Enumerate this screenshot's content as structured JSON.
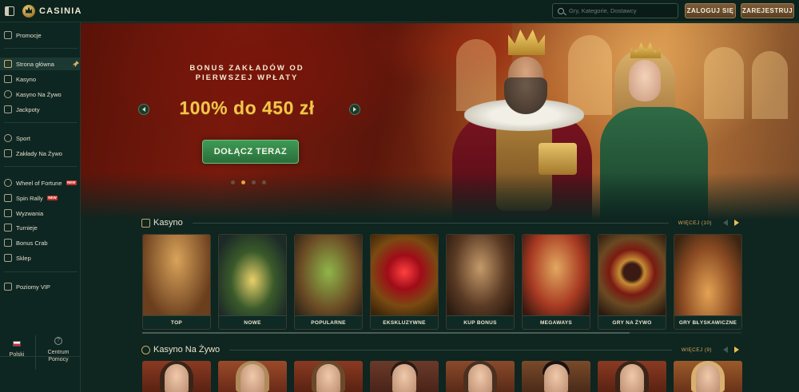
{
  "header": {
    "brand": "CASINIA",
    "search_placeholder": "Gry, Kategorie, Dostawcy",
    "login_label": "ZALOGUJ SIĘ",
    "register_label": "ZAREJESTRUJ"
  },
  "sidebar": {
    "items": [
      {
        "label": "Promocje",
        "icon": "gift-icon"
      },
      {
        "label": "Strona główna",
        "icon": "home-icon",
        "active": true
      },
      {
        "label": "Kasyno",
        "icon": "slot-icon"
      },
      {
        "label": "Kasyno Na Żywo",
        "icon": "chip-icon"
      },
      {
        "label": "Jackpoty",
        "icon": "jackpot-icon"
      },
      {
        "label": "Sport",
        "icon": "ball-icon"
      },
      {
        "label": "Zakłady Na Żywo",
        "icon": "live-bet-icon"
      },
      {
        "label": "Wheel of Fortune",
        "icon": "wheel-icon",
        "badge": "NEW"
      },
      {
        "label": "Spin Rally",
        "icon": "rally-icon",
        "badge": "NEW"
      },
      {
        "label": "Wyzwania",
        "icon": "challenge-icon"
      },
      {
        "label": "Turnieje",
        "icon": "trophy-icon"
      },
      {
        "label": "Bonus Crab",
        "icon": "crab-icon"
      },
      {
        "label": "Sklep",
        "icon": "shop-icon"
      },
      {
        "label": "Poziomy VIP",
        "icon": "vip-icon"
      }
    ],
    "language": "Polski",
    "help_label": "Centrum Pomocy"
  },
  "hero": {
    "subtitle": "BONUS ZAKŁADÓW OD PIERWSZEJ WPŁATY",
    "headline": "100% do 450 zł",
    "cta_label": "DOŁĄCZ TERAZ",
    "slide_count": 4,
    "active_slide": 2
  },
  "casino_section": {
    "title": "Kasyno",
    "more_label": "WIĘCEJ (10)",
    "games": [
      {
        "label": "TOP"
      },
      {
        "label": "NOWE"
      },
      {
        "label": "POPULARNE"
      },
      {
        "label": "EKSKLUZYWNE"
      },
      {
        "label": "KUP BONUS"
      },
      {
        "label": "MEGAWAYS"
      },
      {
        "label": "GRY NA ŻYWO"
      },
      {
        "label": "GRY BŁYSKAWICZNE"
      }
    ]
  },
  "live_section": {
    "title": "Kasyno Na Żywo",
    "more_label": "WIĘCEJ (9)"
  },
  "colors": {
    "background": "#0e2520",
    "accent_gold": "#d2a85a",
    "cta_green": "#3e9a55",
    "headline_gold": "#f3c64a"
  }
}
